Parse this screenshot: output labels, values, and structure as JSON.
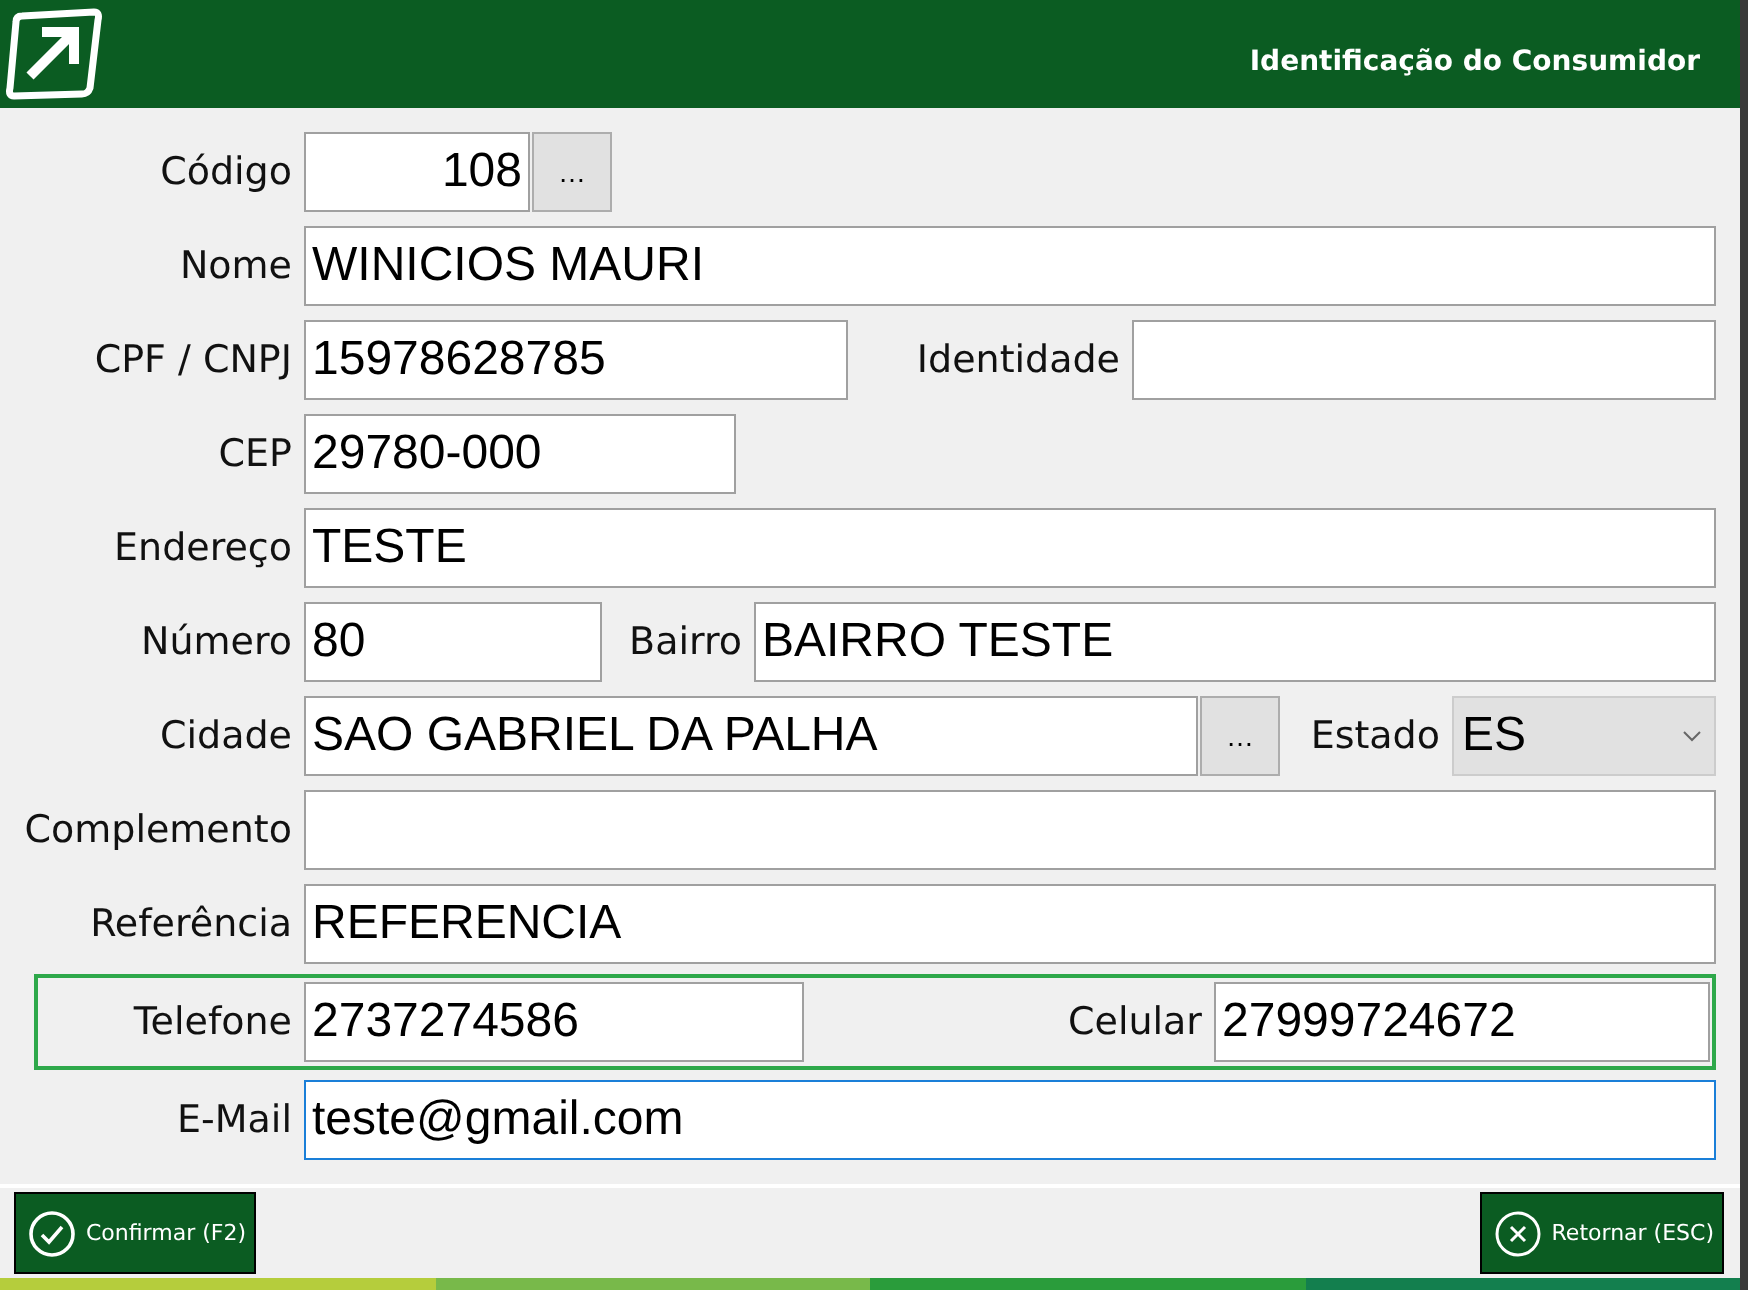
{
  "header": {
    "title": "Identificação do Consumidor"
  },
  "form": {
    "codigo": {
      "label": "Código",
      "value": "108",
      "button": "…",
      "focused": false
    },
    "nome": {
      "label": "Nome",
      "value": "WINICIOS MAURI",
      "focused": false
    },
    "cpf": {
      "label": "CPF / CNPJ",
      "value": "15978628785",
      "focused": false
    },
    "identidade": {
      "label": "Identidade",
      "focused": false
    },
    "cep": {
      "label": "CEP",
      "value": "29780-000",
      "focused": false
    },
    "endereco": {
      "label": "Endereço",
      "value": "TESTE",
      "focused": false
    },
    "numero": {
      "label": "Número",
      "value": "80",
      "focused": false
    },
    "bairro": {
      "label": "Bairro",
      "value": "BAIRRO TESTE",
      "focused": false
    },
    "cidade": {
      "label": "Cidade",
      "value": "SAO GABRIEL DA PALHA",
      "button": "…",
      "focused": false
    },
    "estado": {
      "label": "Estado",
      "value": "ES"
    },
    "complemento": {
      "label": "Complemento",
      "focused": false
    },
    "referencia": {
      "label": "Referência",
      "value": "REFERENCIA",
      "focused": false
    },
    "telefone": {
      "label": "Telefone",
      "value": "2737274586",
      "focused": false
    },
    "celular": {
      "label": "Celular",
      "value": "27999724672",
      "focused": false
    },
    "email": {
      "label": "E-Mail",
      "value": "teste@gmail.com",
      "focused": true
    }
  },
  "buttons": [
    {
      "kind": "confirm",
      "label": "Confirmar (F2)"
    },
    {
      "kind": "cancel",
      "label": "Retornar (ESC)"
    }
  ]
}
